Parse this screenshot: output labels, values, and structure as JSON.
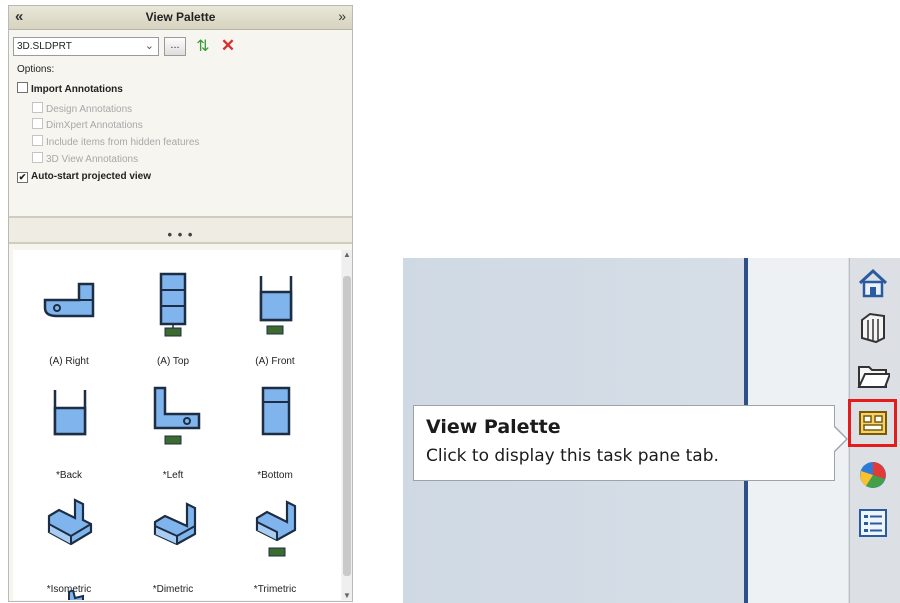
{
  "panel": {
    "title": "View Palette",
    "collapse_glyph": "«",
    "pin_glyph": "»",
    "part_select_value": "3D.SLDPRT",
    "browse_label": "...",
    "options_label": "Options:",
    "checkboxes": {
      "import": "Import Annotations",
      "design": "Design Annotations",
      "dimxpert": "DimXpert Annotations",
      "hidden": "Include items from hidden features",
      "view3d": "3D View Annotations",
      "autostart": "Auto-start projected view"
    },
    "splitter_grip": "• • •",
    "views": [
      {
        "label": "(A) Right",
        "icon": "right-view-icon"
      },
      {
        "label": "(A) Top",
        "icon": "top-view-icon"
      },
      {
        "label": "(A) Front",
        "icon": "front-view-icon"
      },
      {
        "label": "*Back",
        "icon": "back-view-icon"
      },
      {
        "label": "*Left",
        "icon": "left-view-icon"
      },
      {
        "label": "*Bottom",
        "icon": "bottom-view-icon"
      },
      {
        "label": "*Isometric",
        "icon": "isometric-view-icon"
      },
      {
        "label": "*Dimetric",
        "icon": "dimetric-view-icon"
      },
      {
        "label": "*Trimetric",
        "icon": "trimetric-view-icon"
      }
    ]
  },
  "tooltip": {
    "title": "View Palette",
    "body": "Click to display this task pane tab."
  },
  "taskpane_tabs": [
    "home-icon",
    "design-library-icon",
    "file-explorer-icon",
    "view-palette-icon",
    "appearances-icon",
    "custom-properties-icon"
  ],
  "colors": {
    "part_blue": "#7fb5ec",
    "highlight_red": "#e51c1c",
    "accent_blue": "#2e4f88"
  }
}
